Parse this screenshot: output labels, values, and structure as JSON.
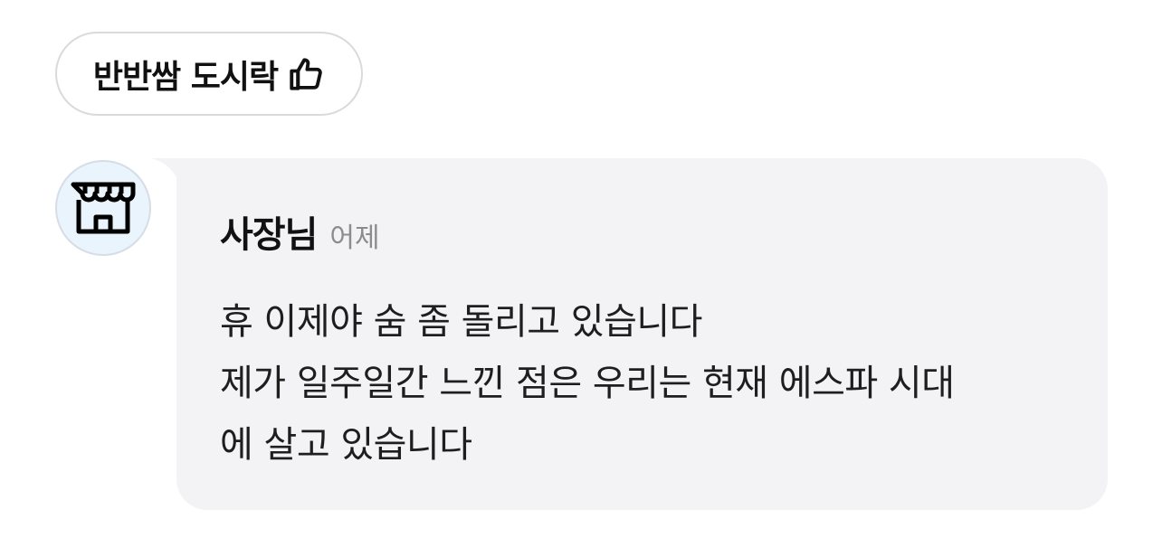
{
  "menu_chip": {
    "label": "반반쌈 도시락",
    "icon": "thumbs-up-icon"
  },
  "reply": {
    "avatar_icon": "store-icon",
    "author": "사장님",
    "time": "어제",
    "lines": [
      "휴 이제야 숨 좀 돌리고 있습니다",
      "제가 일주일간 느낀 점은 우리는 현재 에스파 시대",
      "에 살고 있습니다"
    ]
  },
  "colors": {
    "bubble_background": "#f3f3f5",
    "avatar_background": "#eaf4fc",
    "chip_border": "#dadada",
    "time_text": "#8c8c8c"
  }
}
